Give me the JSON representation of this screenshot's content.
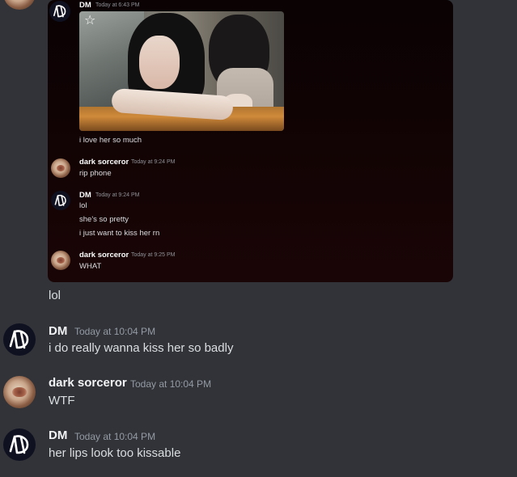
{
  "embed": {
    "messages": [
      {
        "author": "DM",
        "time": "Today at 6:43 PM",
        "avatar": "dm-logo-icon",
        "lines": [
          "i love her so much"
        ],
        "has_image": true
      },
      {
        "author": "dark sorceror",
        "time": "Today at 9:24 PM",
        "avatar": "donut-avatar",
        "lines": [
          "rip phone"
        ]
      },
      {
        "author": "DM",
        "time": "Today at 9:24 PM",
        "avatar": "dm-logo-icon",
        "lines": [
          "lol",
          "she's so pretty",
          "i just want to kiss her rn"
        ]
      },
      {
        "author": "dark sorceror",
        "time": "Today at 9:25 PM",
        "avatar": "donut-avatar",
        "lines": [
          "WHAT"
        ]
      }
    ]
  },
  "chat": {
    "continuation": "lol",
    "messages": [
      {
        "author": "DM",
        "time": "Today at 10:04 PM",
        "avatar": "dm-logo-icon",
        "text": "i do really wanna kiss her so badly"
      },
      {
        "author": "dark sorceror",
        "time": "Today at 10:04 PM",
        "avatar": "donut-avatar",
        "text": "WTF"
      },
      {
        "author": "DM",
        "time": "Today at 10:04 PM",
        "avatar": "dm-logo-icon",
        "text": "her lips look too kissable"
      }
    ]
  },
  "colors": {
    "background": "#313338",
    "embed_background": "#110304",
    "username": "#f2f3f5",
    "timestamp": "#949ba4",
    "message_text": "#dbdee1"
  }
}
